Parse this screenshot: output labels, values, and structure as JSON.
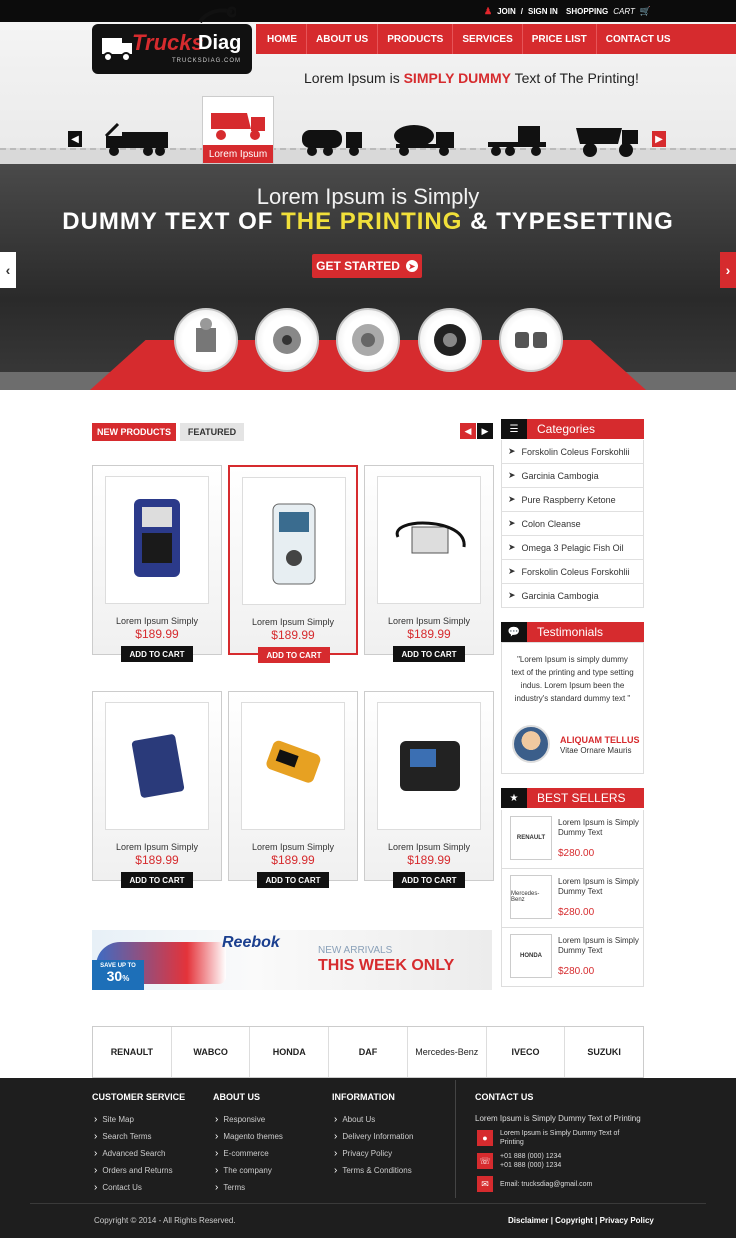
{
  "topbar": {
    "join": "JOIN",
    "sep": "/",
    "signin": "SIGN IN",
    "shopping": "SHOPPING",
    "cart": "CART"
  },
  "logo": {
    "main": "Trucks",
    "accent": "Diag",
    "domain": "TRUCKSDIAG.COM"
  },
  "nav": [
    "HOME",
    "ABOUT US",
    "PRODUCTS",
    "SERVICES",
    "PRICE LIST",
    "CONTACT US"
  ],
  "tagline": {
    "pre": "Lorem Ipsum is ",
    "em": "SIMPLY DUMMY",
    "post": " Text of The Printing!"
  },
  "slider": {
    "active_label": "Lorem Ipsum"
  },
  "hero": {
    "line1": "Lorem Ipsum is Simply",
    "line2_a": "DUMMY TEXT OF ",
    "line2_b": "THE PRINTING",
    "line2_c": " & TYPESETTING",
    "cta": "GET STARTED"
  },
  "tabs": {
    "new": "NEW PRODUCTS",
    "featured": "FEATURED"
  },
  "products": [
    {
      "name": "Lorem Ipsum Simply",
      "price": "$189.99",
      "btn": "ADD TO CART"
    },
    {
      "name": "Lorem Ipsum Simply",
      "price": "$189.99",
      "btn": "ADD TO CART"
    },
    {
      "name": "Lorem Ipsum Simply",
      "price": "$189.99",
      "btn": "ADD TO CART"
    },
    {
      "name": "Lorem Ipsum Simply",
      "price": "$189.99",
      "btn": "ADD TO CART"
    },
    {
      "name": "Lorem Ipsum Simply",
      "price": "$189.99",
      "btn": "ADD TO CART"
    },
    {
      "name": "Lorem Ipsum Simply",
      "price": "$189.99",
      "btn": "ADD TO CART"
    }
  ],
  "categories": {
    "title": "Categories",
    "items": [
      "Forskolin Coleus Forskohlii",
      "Garcinia Cambogia",
      "Pure Raspberry Ketone",
      "Colon Cleanse",
      "Omega 3 Pelagic Fish Oil",
      "Forskolin Coleus Forskohlii",
      "Garcinia Cambogia"
    ]
  },
  "testimonials": {
    "title": "Testimonials",
    "quote": "\"Lorem Ipsum is simply dummy text of the printing and type setting indus. Lorem Ipsum been the industry's standard dummy text \"",
    "name": "ALIQUAM TELLUS",
    "role": "Vitae Ornare Mauris"
  },
  "bestsellers": {
    "title": "BEST SELLERS",
    "items": [
      {
        "brand": "RENAULT",
        "text": "Lorem Ipsum is Simply Dummy Text",
        "price": "$280.00"
      },
      {
        "brand": "Mercedes-Benz",
        "text": "Lorem Ipsum is Simply Dummy Text",
        "price": "$280.00"
      },
      {
        "brand": "HONDA",
        "text": "Lorem Ipsum is Simply Dummy Text",
        "price": "$280.00"
      }
    ]
  },
  "banner": {
    "save": "SAVE UP TO",
    "pct": "30",
    "pct_sign": "%",
    "brand": "Reebok",
    "new": "NEW ARRIVALS",
    "week": "THIS WEEK ONLY"
  },
  "brands": [
    "RENAULT",
    "WABCO",
    "HONDA",
    "DAF",
    "Mercedes-Benz",
    "IVECO",
    "SUZUKI"
  ],
  "footer": {
    "cs_title": "CUSTOMER SERVICE",
    "cs": [
      "Site Map",
      "Search Terms",
      "Advanced Search",
      "Orders and Returns",
      "Contact Us"
    ],
    "about_title": "ABOUT US",
    "about": [
      "Responsive",
      "Magento themes",
      "E-commerce",
      "The company",
      "Terms"
    ],
    "info_title": "INFORMATION",
    "info": [
      "About Us",
      "Delivery Information",
      "Privacy Policy",
      "Terms & Conditions"
    ],
    "contact_title": "CONTACT US",
    "contact_intro": "Lorem Ipsum is Simply Dummy Text of Printing",
    "address": "Lorem Ipsum is Simply Dummy Text of Printing",
    "phone1": "+01 888 (000) 1234",
    "phone2": "+01 888 (000) 1234",
    "email": "Email: trucksdiag@gmail.com",
    "copyright": "Copyright © 2014 - All Rights Reserved.",
    "disclaimer": "Disclaimer",
    "copy": "Copyright",
    "privacy": "Privacy Policy"
  },
  "colors": {
    "accent": "#d62b2e",
    "dark": "#111111",
    "highlight": "#f1e03a"
  }
}
